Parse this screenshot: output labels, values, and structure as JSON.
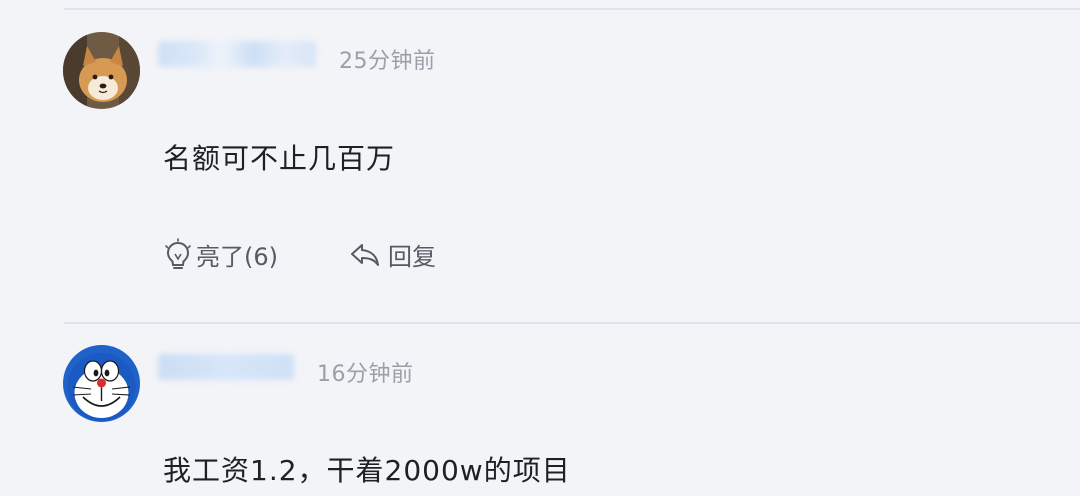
{
  "comments": [
    {
      "time": "25分钟前",
      "text": "名额可不止几百万",
      "like_label": "亮了(6)",
      "reply_label": "回复",
      "avatar": "shiba-dog-avatar"
    },
    {
      "time": "16分钟前",
      "text": "我工资1.2，干着2000w的项目",
      "avatar": "doraemon-avatar"
    }
  ],
  "colors": {
    "background": "#f3f4f8",
    "divider": "#e1e3ea",
    "timestamp": "#9aa0aa",
    "text": "#1f2024",
    "action": "#555a63"
  }
}
